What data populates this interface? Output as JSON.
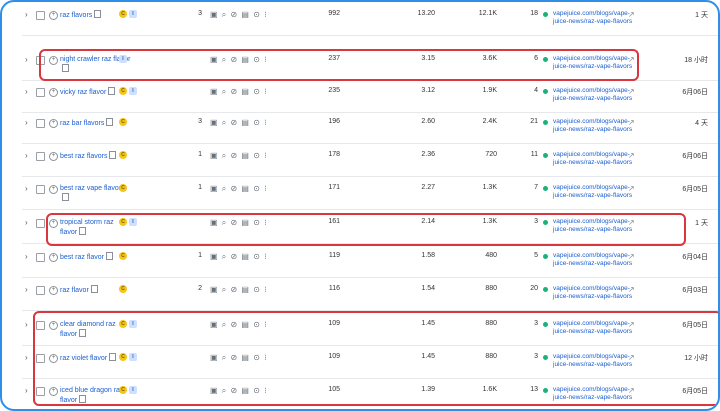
{
  "colors": {
    "frame": "#2f8fe8",
    "link": "#1a5fd0",
    "highlight": "#d9363e",
    "status_dot": "#1bb27a",
    "badge_c": "#f5c518",
    "badge_i": "#cfe0ff"
  },
  "badges": {
    "c": "C",
    "i": "I"
  },
  "rows": [
    {
      "keyword": "raz flavors",
      "c": true,
      "i": true,
      "count": "3",
      "volume": "992",
      "kd": "13.20",
      "cpc": "12.1K",
      "rank": "18",
      "url": "vapejuice.com/blogs/vape-juice-news/raz-vape-flavors",
      "updated": "1 天"
    },
    {
      "keyword": "night crawler raz flavor",
      "c": false,
      "i": true,
      "count": "",
      "volume": "237",
      "kd": "3.15",
      "cpc": "3.6K",
      "rank": "6",
      "url": "vapejuice.com/blogs/vape-juice-news/raz-vape-flavors",
      "updated": "18 小时"
    },
    {
      "keyword": "vicky raz flavor",
      "c": true,
      "i": true,
      "count": "",
      "volume": "235",
      "kd": "3.12",
      "cpc": "1.9K",
      "rank": "4",
      "url": "vapejuice.com/blogs/vape-juice-news/raz-vape-flavors",
      "updated": "6月06日"
    },
    {
      "keyword": "raz bar flavors",
      "c": true,
      "i": false,
      "count": "3",
      "volume": "196",
      "kd": "2.60",
      "cpc": "2.4K",
      "rank": "21",
      "url": "vapejuice.com/blogs/vape-juice-news/raz-vape-flavors",
      "updated": "4 天"
    },
    {
      "keyword": "best raz flavors",
      "c": true,
      "i": false,
      "count": "1",
      "volume": "178",
      "kd": "2.36",
      "cpc": "720",
      "rank": "11",
      "url": "vapejuice.com/blogs/vape-juice-news/raz-vape-flavors",
      "updated": "6月06日"
    },
    {
      "keyword": "best raz vape flavors",
      "c": true,
      "i": false,
      "count": "1",
      "volume": "171",
      "kd": "2.27",
      "cpc": "1.3K",
      "rank": "7",
      "url": "vapejuice.com/blogs/vape-juice-news/raz-vape-flavors",
      "updated": "6月05日"
    },
    {
      "keyword": "tropical storm raz flavor",
      "c": true,
      "i": true,
      "count": "",
      "volume": "161",
      "kd": "2.14",
      "cpc": "1.3K",
      "rank": "3",
      "url": "vapejuice.com/blogs/vape-juice-news/raz-vape-flavors",
      "updated": "1 天"
    },
    {
      "keyword": "best raz flavor",
      "c": true,
      "i": false,
      "count": "1",
      "volume": "119",
      "kd": "1.58",
      "cpc": "480",
      "rank": "5",
      "url": "vapejuice.com/blogs/vape-juice-news/raz-vape-flavors",
      "updated": "6月04日"
    },
    {
      "keyword": "raz flavor",
      "c": true,
      "i": false,
      "count": "2",
      "volume": "116",
      "kd": "1.54",
      "cpc": "880",
      "rank": "20",
      "url": "vapejuice.com/blogs/vape-juice-news/raz-vape-flavors",
      "updated": "6月03日"
    },
    {
      "keyword": "clear diamond raz flavor",
      "c": true,
      "i": true,
      "count": "",
      "volume": "109",
      "kd": "1.45",
      "cpc": "880",
      "rank": "3",
      "url": "vapejuice.com/blogs/vape-juice-news/raz-vape-flavors",
      "updated": "6月05日"
    },
    {
      "keyword": "raz violet flavor",
      "c": true,
      "i": true,
      "count": "",
      "volume": "109",
      "kd": "1.45",
      "cpc": "880",
      "rank": "3",
      "url": "vapejuice.com/blogs/vape-juice-news/raz-vape-flavors",
      "updated": "12 小时"
    },
    {
      "keyword": "iced blue dragon raz flavor",
      "c": true,
      "i": true,
      "count": "",
      "volume": "105",
      "kd": "1.39",
      "cpc": "1.6K",
      "rank": "13",
      "url": "vapejuice.com/blogs/vape-juice-news/raz-vape-flavors",
      "updated": "6月05日"
    }
  ]
}
